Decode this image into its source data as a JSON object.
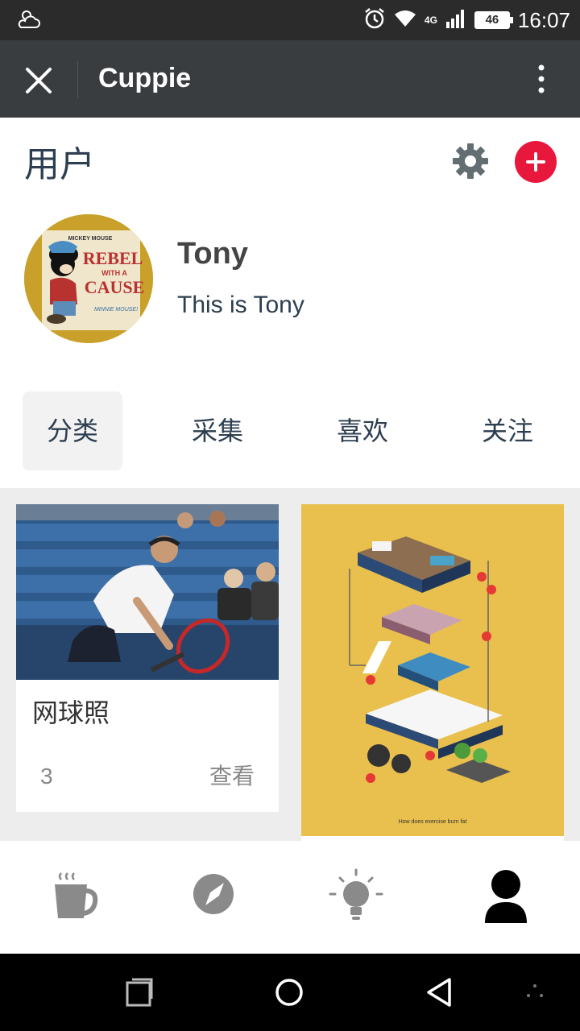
{
  "status_bar": {
    "time": "16:07",
    "battery": "46",
    "network": "4G",
    "icons": [
      "weather-icon",
      "alarm-icon",
      "wifi-icon",
      "signal-icon",
      "battery-icon"
    ]
  },
  "title_bar": {
    "title": "Cuppie",
    "close_icon": "close-icon",
    "more_icon": "more-vert-icon"
  },
  "header": {
    "title": "用户",
    "settings_icon": "gear-icon",
    "add_icon": "plus-icon",
    "accent_color": "#e8173c"
  },
  "profile": {
    "name": "Tony",
    "bio": "This is Tony",
    "avatar_text": [
      "MICKEY MOUSE",
      "REBEL",
      "WITH A",
      "CAUSE",
      "MINNIE MOUSE!"
    ]
  },
  "tabs": [
    {
      "label": "分类",
      "active": true
    },
    {
      "label": "采集",
      "active": false
    },
    {
      "label": "喜欢",
      "active": false
    },
    {
      "label": "关注",
      "active": false
    }
  ],
  "cards": [
    {
      "title": "网球照",
      "count": "3",
      "action": "查看"
    },
    {
      "poster_caption": "How does exercise burn fat"
    }
  ],
  "bottom_nav": [
    {
      "icon": "coffee-cup-icon",
      "active": false
    },
    {
      "icon": "compass-icon",
      "active": false
    },
    {
      "icon": "lightbulb-icon",
      "active": false
    },
    {
      "icon": "user-icon",
      "active": true
    }
  ],
  "system_nav": [
    "recents-icon",
    "home-icon",
    "back-icon",
    "assistant-icon"
  ]
}
